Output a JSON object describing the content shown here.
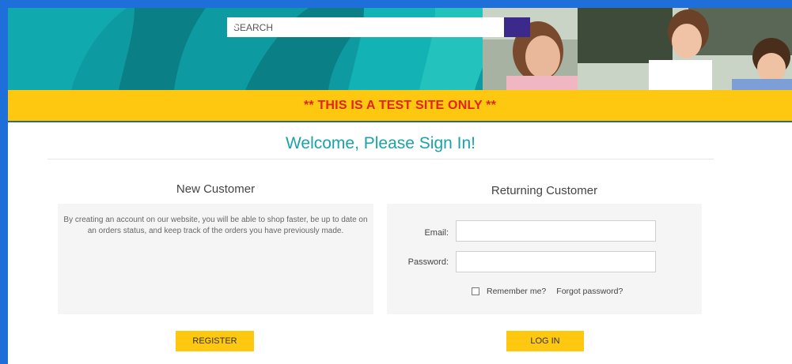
{
  "header": {
    "search": {
      "placeholder": "SEARCH",
      "button_icon": "search-icon"
    },
    "colors": {
      "teal": "#0c8f97",
      "search_button": "#3b2a8c",
      "test_bar": "#fdc80f",
      "test_text": "#e2231a"
    }
  },
  "notice": {
    "text": "** THIS IS A TEST SITE ONLY **"
  },
  "page": {
    "title": "Welcome, Please Sign In!"
  },
  "new_customer": {
    "title": "New Customer",
    "description": "By creating an account on our website, you will be able to shop faster, be up to date on an orders status, and keep track of the orders you have previously made.",
    "register_label": "REGISTER"
  },
  "returning_customer": {
    "title": "Returning Customer",
    "email_label": "Email:",
    "password_label": "Password:",
    "remember_label": "Remember me?",
    "forgot_label": "Forgot password?",
    "login_label": "LOG IN"
  }
}
